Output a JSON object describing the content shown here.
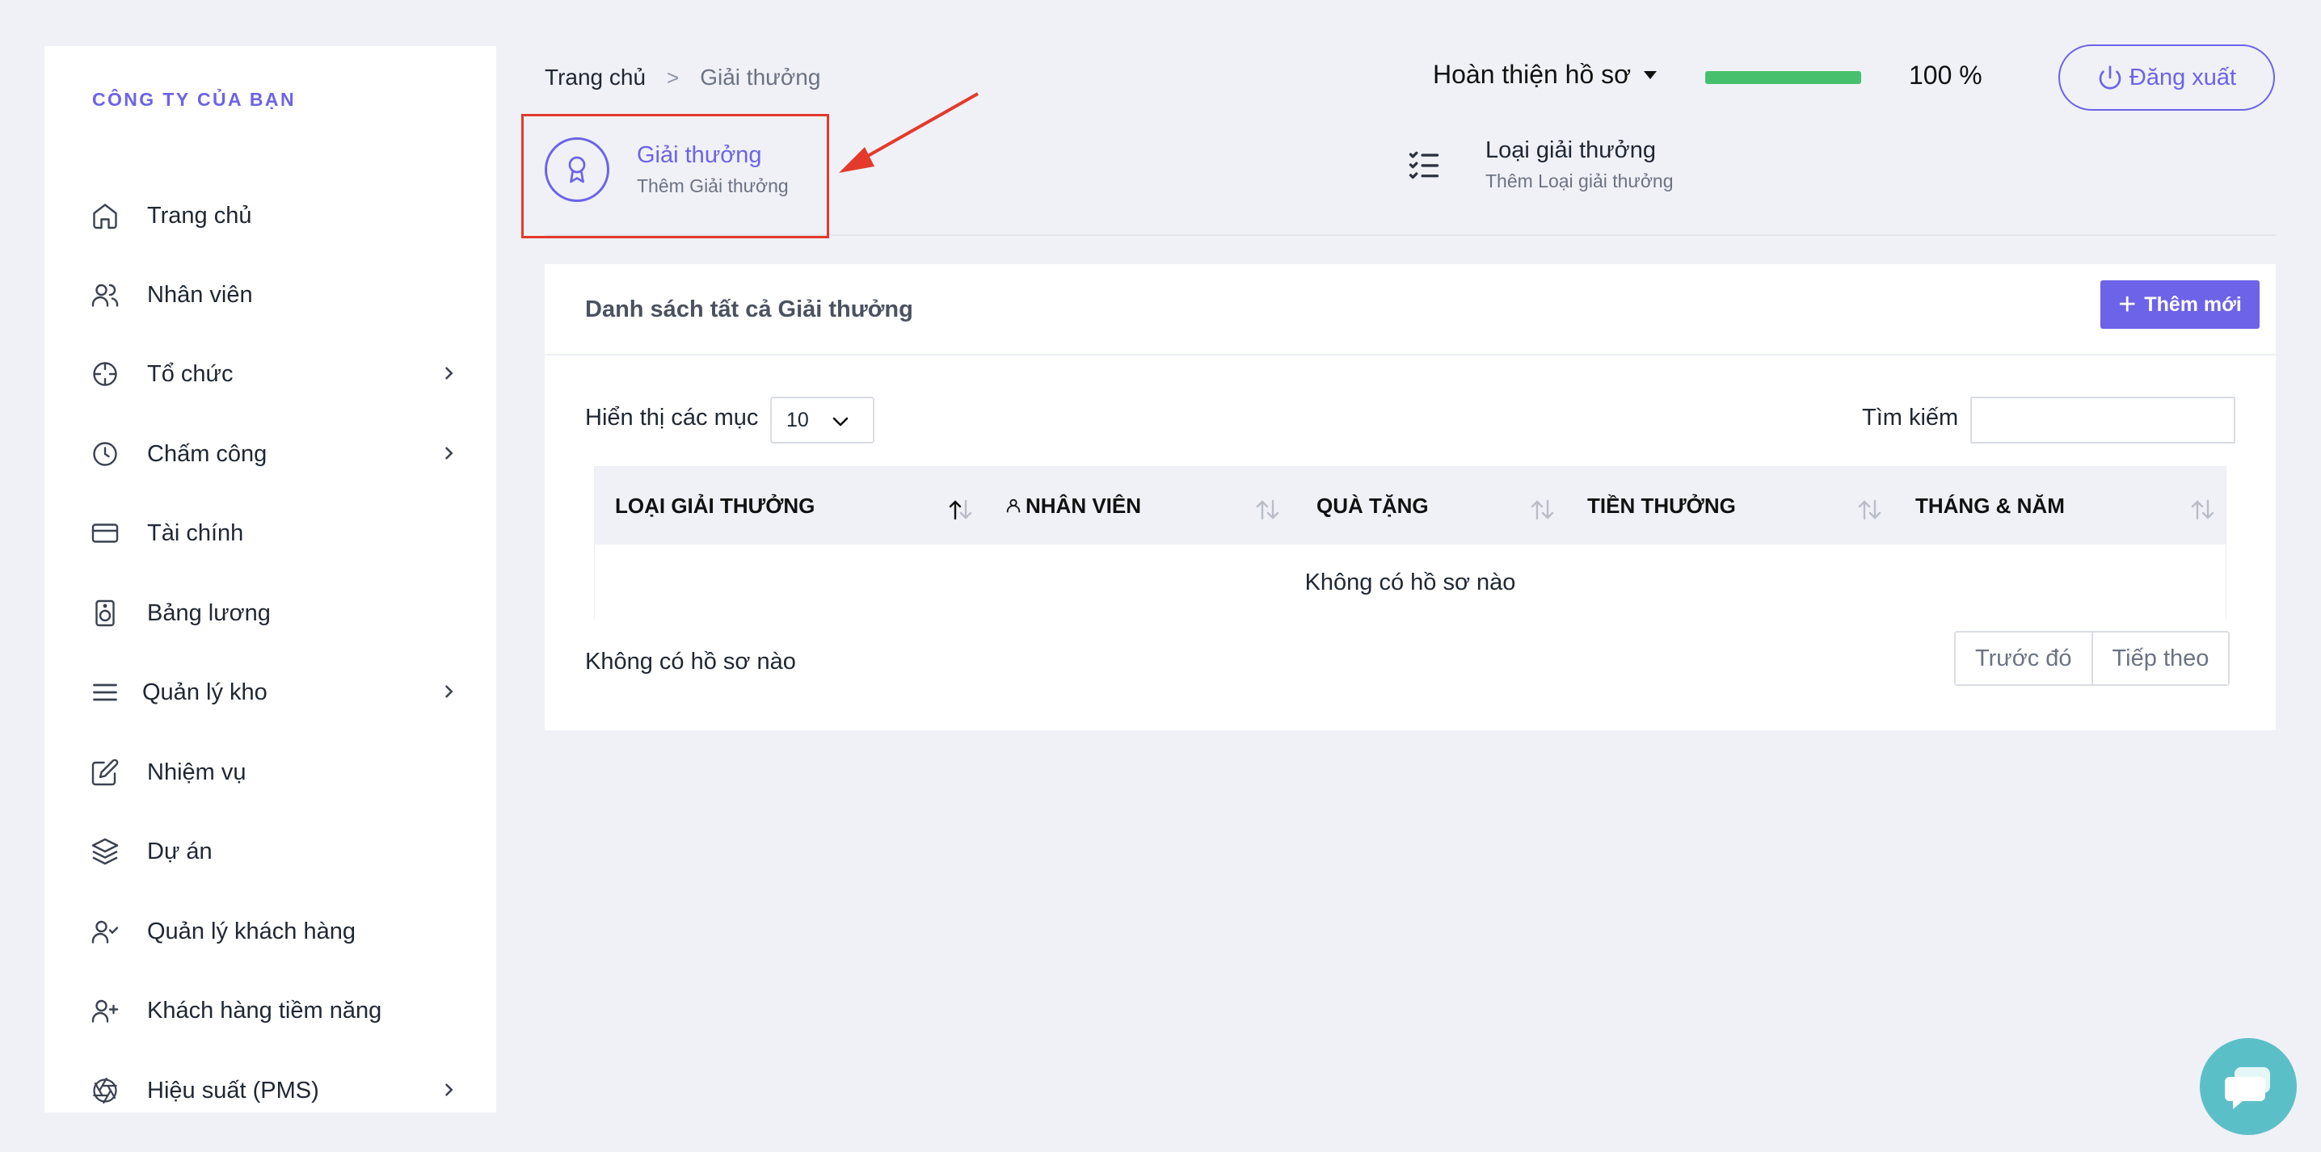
{
  "sidebar": {
    "company": "CÔNG TY CỦA BẠN",
    "items": [
      {
        "label": "Trang chủ",
        "icon": "home-icon"
      },
      {
        "label": "Nhân viên",
        "icon": "users-icon"
      },
      {
        "label": "Tổ chức",
        "icon": "crosshair-icon",
        "has_children": true
      },
      {
        "label": "Chấm công",
        "icon": "clock-icon",
        "has_children": true
      },
      {
        "label": "Tài chính",
        "icon": "credit-card-icon"
      },
      {
        "label": "Bảng lương",
        "icon": "speaker-icon"
      },
      {
        "label": "Quản lý kho",
        "icon": "menu-lines-icon",
        "has_children": true
      },
      {
        "label": "Nhiệm vụ",
        "icon": "edit-icon"
      },
      {
        "label": "Dự án",
        "icon": "layers-icon"
      },
      {
        "label": "Quản lý khách hàng",
        "icon": "user-check-icon"
      },
      {
        "label": "Khách hàng tiềm năng",
        "icon": "user-plus-icon"
      },
      {
        "label": "Hiệu suất (PMS)",
        "icon": "aperture-icon",
        "has_children": true
      }
    ]
  },
  "breadcrumb": {
    "home": "Trang chủ",
    "separator": ">",
    "current": "Giải thưởng"
  },
  "header": {
    "profile_label": "Hoàn thiện hồ sơ",
    "progress_value": 100,
    "progress_text": "100 %",
    "progress_color": "#47c06d",
    "logout_label": "Đăng xuất"
  },
  "tabs": [
    {
      "title": "Giải thưởng",
      "subtitle": "Thêm Giải thưởng",
      "icon": "award-icon",
      "active": true
    },
    {
      "title": "Loại giải thưởng",
      "subtitle": "Thêm Loại giải thưởng",
      "icon": "list-check-icon",
      "active": false
    }
  ],
  "card": {
    "title": "Danh sách tất cả Giải thưởng",
    "add_label": "Thêm mới",
    "show_label": "Hiển thị các mục",
    "page_size": "10",
    "search_label": "Tìm kiếm",
    "search_value": "",
    "columns": [
      "LOẠI GIẢI THƯỞNG",
      "NHÂN VIÊN",
      "QUÀ TẶNG",
      "TIỀN THƯỞNG",
      "THÁNG & NĂM"
    ],
    "empty_message": "Không có hồ sơ nào",
    "info_text": "Không có hồ sơ nào",
    "prev_label": "Trước đó",
    "next_label": "Tiếp theo"
  },
  "colors": {
    "accent": "#6c63e8",
    "highlight": "#e33a2b",
    "chat": "#5bbfc8"
  }
}
